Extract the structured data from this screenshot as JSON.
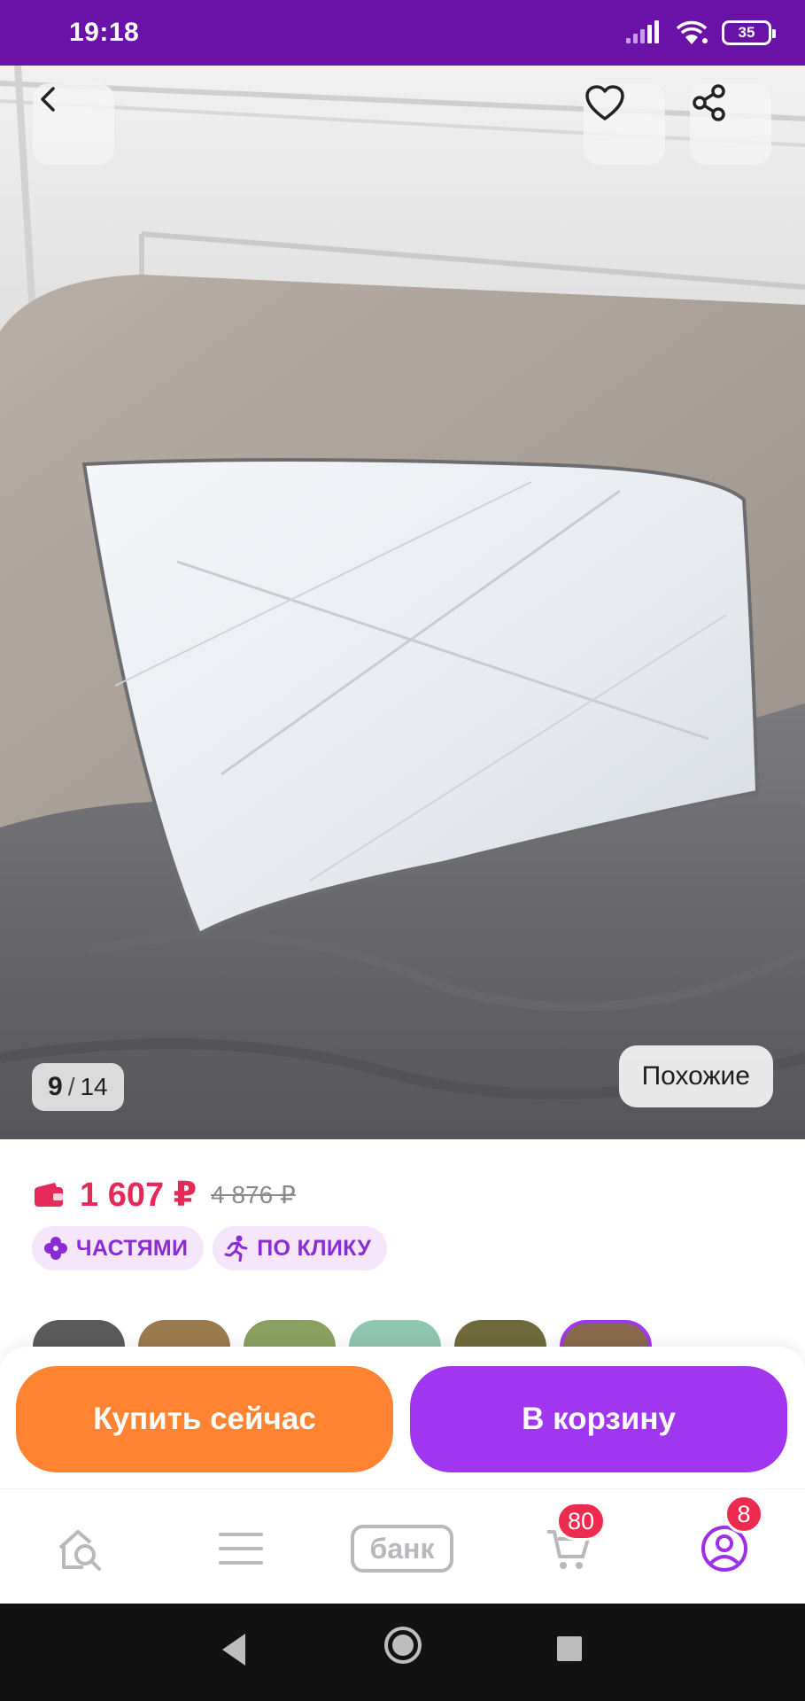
{
  "status_bar": {
    "time": "19:18",
    "battery": "35",
    "icons": [
      "signal-icon",
      "wifi-icon",
      "battery-icon"
    ]
  },
  "gallery": {
    "current": "9",
    "separator": "/",
    "total": "14",
    "similar_label": "Похожие"
  },
  "product": {
    "price": "1 607 ₽",
    "old_price": "4 876 ₽",
    "tags": [
      {
        "label": "ЧАСТЯМИ",
        "icon": "flower-icon"
      },
      {
        "label": "ПО КЛИКУ",
        "icon": "running-person-icon"
      }
    ]
  },
  "actions": {
    "buy_now": "Купить сейчас",
    "add_to_cart": "В корзину"
  },
  "bottom_nav": {
    "home_icon": "home-search-icon",
    "catalog_icon": "menu-icon",
    "bank_label": "банк",
    "cart_badge": "80",
    "profile_badge": "8"
  },
  "colors": {
    "status_bar": "#6a12a8",
    "price": "#e52a5a",
    "buy_button": "#ff8330",
    "cart_button": "#a036f0",
    "tag_bg": "#f5e6fb",
    "tag_text": "#8a2bd6",
    "badge": "#ef2a4f"
  }
}
